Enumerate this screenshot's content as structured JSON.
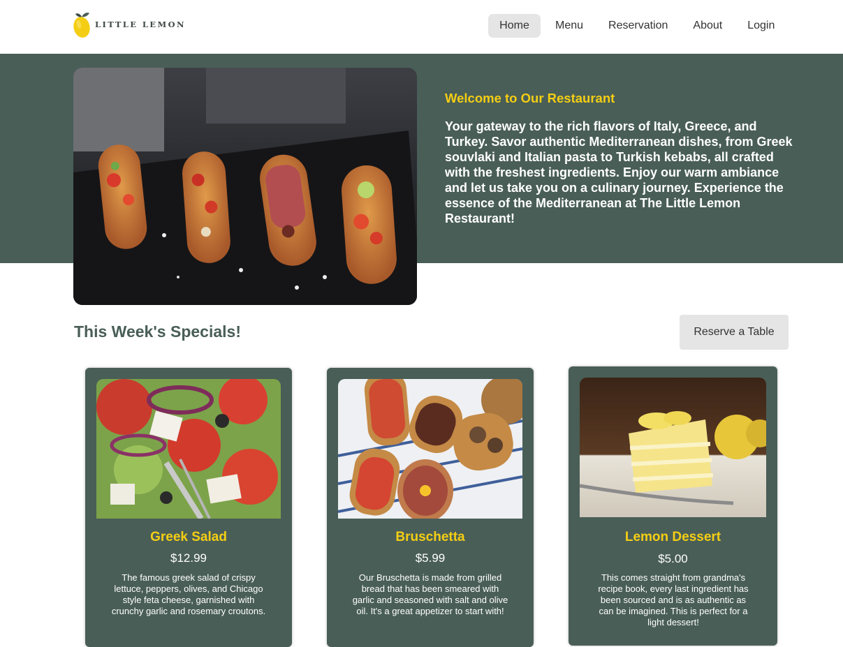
{
  "brand": {
    "logo_text": "LITTLE LEMON"
  },
  "nav": {
    "items": [
      {
        "label": "Home",
        "active": true
      },
      {
        "label": "Menu",
        "active": false
      },
      {
        "label": "Reservation",
        "active": false
      },
      {
        "label": "About",
        "active": false
      },
      {
        "label": "Login",
        "active": false
      }
    ]
  },
  "hero": {
    "heading": "Welcome to Our Restaurant",
    "text": "Your gateway to the rich flavors of Italy, Greece, and Turkey. Savor authentic Mediterranean dishes, from Greek souvlaki and Italian pasta to Turkish kebabs, all crafted with the freshest ingredients. Enjoy our warm ambiance and let us take you on a culinary journey. Experience the essence of the Mediterranean at The Little Lemon Restaurant!"
  },
  "specials": {
    "title": "This Week's Specials!",
    "reserve_button": "Reserve a Table",
    "items": [
      {
        "name": "Greek Salad",
        "price": "$12.99",
        "description": "The famous greek salad of crispy lettuce, peppers, olives, and Chicago style feta cheese, garnished with crunchy garlic and rosemary croutons."
      },
      {
        "name": "Bruschetta",
        "price": "$5.99",
        "description": "Our Bruschetta is made from grilled bread that has been smeared with garlic and seasoned with salt and olive oil. It's a great appetizer to start with!"
      },
      {
        "name": "Lemon Dessert",
        "price": "$5.00",
        "description": "This comes straight from grandma's recipe book, every last ingredient has been sourced and is as authentic as can be imagined. This is perfect for a light dessert!"
      }
    ]
  },
  "colors": {
    "primary_green": "#495e57",
    "primary_yellow": "#f4ce14",
    "button_gray": "#e5e5e5"
  }
}
